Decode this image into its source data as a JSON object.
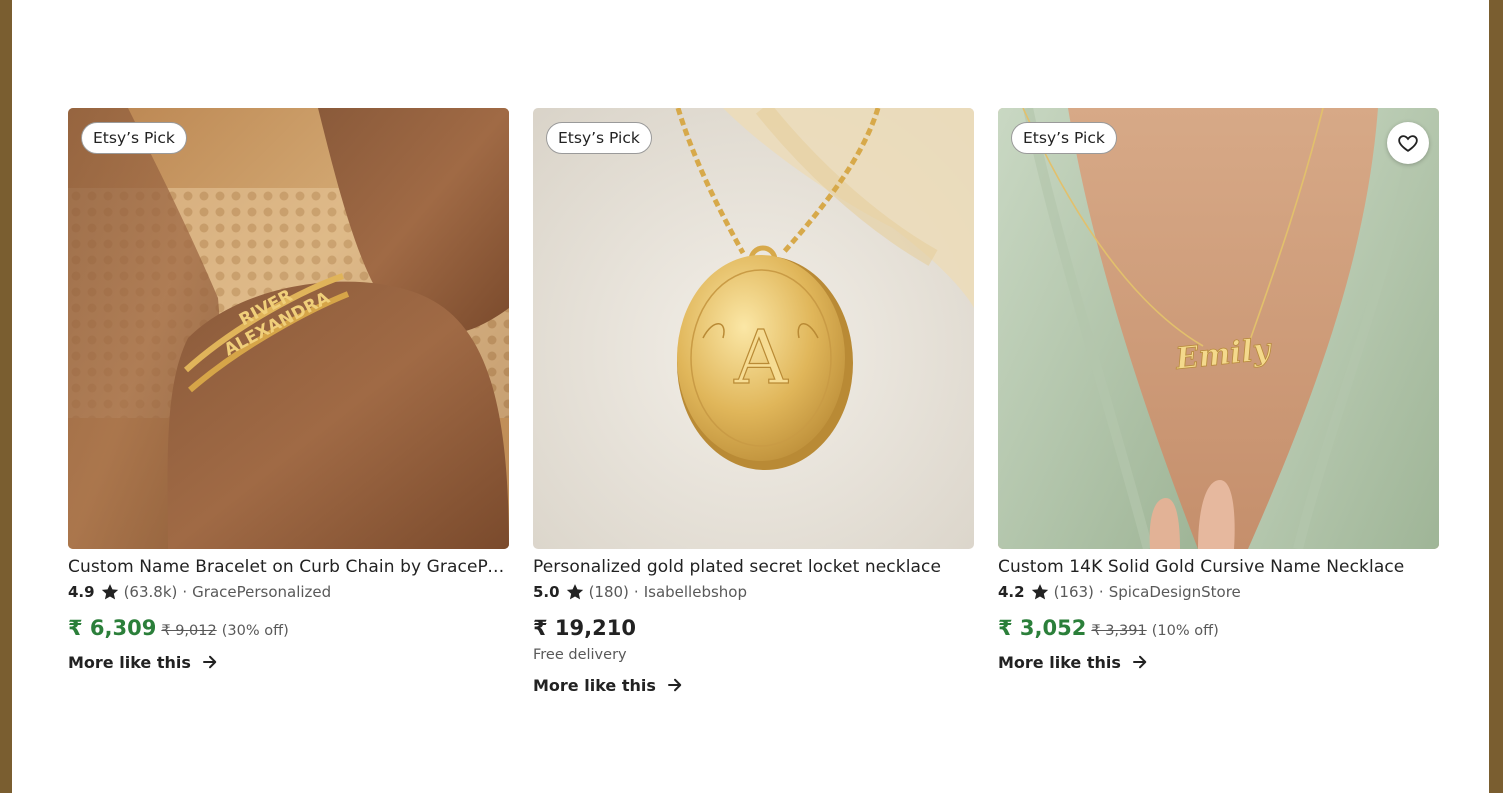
{
  "listings": [
    {
      "badge": "Etsy’s Pick",
      "title": "Custom Name Bracelet on Curb Chain by GracePersonalized",
      "rating": "4.9",
      "reviews": "(63.8k)",
      "separator": "·",
      "shop": "GracePersonalized",
      "price": "₹ 6,309",
      "original_price": "₹ 9,012",
      "discount": "(30% off)",
      "more_label": "More like this",
      "image_icon": "bracelet-photo",
      "price_color": "#2b7f3a"
    },
    {
      "badge": "Etsy’s Pick",
      "title": "Personalized gold plated secret locket necklace",
      "rating": "5.0",
      "reviews": "(180)",
      "separator": "·",
      "shop": "Isabellebshop",
      "price": "₹ 19,210",
      "delivery": "Free delivery",
      "more_label": "More like this",
      "image_icon": "locket-photo",
      "price_color": "#222222"
    },
    {
      "badge": "Etsy’s Pick",
      "title": "Custom 14K Solid Gold Cursive Name Necklace",
      "rating": "4.2",
      "reviews": "(163)",
      "separator": "·",
      "shop": "SpicaDesignStore",
      "price": "₹ 3,052",
      "original_price": "₹ 3,391",
      "discount": "(10% off)",
      "more_label": "More like this",
      "image_icon": "necklace-photo",
      "price_color": "#2b7f3a",
      "favorite_icon": "heart-icon"
    }
  ],
  "photo_text": {
    "bracelet_line1": "RIVER",
    "bracelet_line2": "ALEXANDRA",
    "locket_initial": "A",
    "necklace_name": "Emily"
  },
  "colors": {
    "frame": "#7a5e30",
    "sale_green": "#2b7f3a",
    "text": "#222222",
    "muted": "#595959"
  }
}
